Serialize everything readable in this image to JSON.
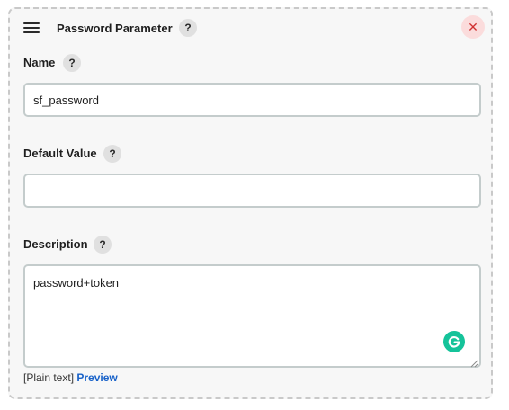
{
  "header": {
    "title": "Password Parameter",
    "drag_icon": "hamburger-menu-icon",
    "help_glyph": "?",
    "close_glyph": "✕"
  },
  "fields": {
    "name": {
      "label": "Name",
      "help_glyph": "?",
      "value": "sf_password"
    },
    "default_value": {
      "label": "Default Value",
      "help_glyph": "?",
      "value": ""
    },
    "description": {
      "label": "Description",
      "help_glyph": "?",
      "value": "password+token"
    }
  },
  "footer": {
    "format_text": "[Plain text]",
    "preview_link": "Preview"
  },
  "colors": {
    "close_bg": "#fbdcdc",
    "close_fg": "#d03131",
    "link": "#1a63c9",
    "grammarly": "#15c39a"
  }
}
